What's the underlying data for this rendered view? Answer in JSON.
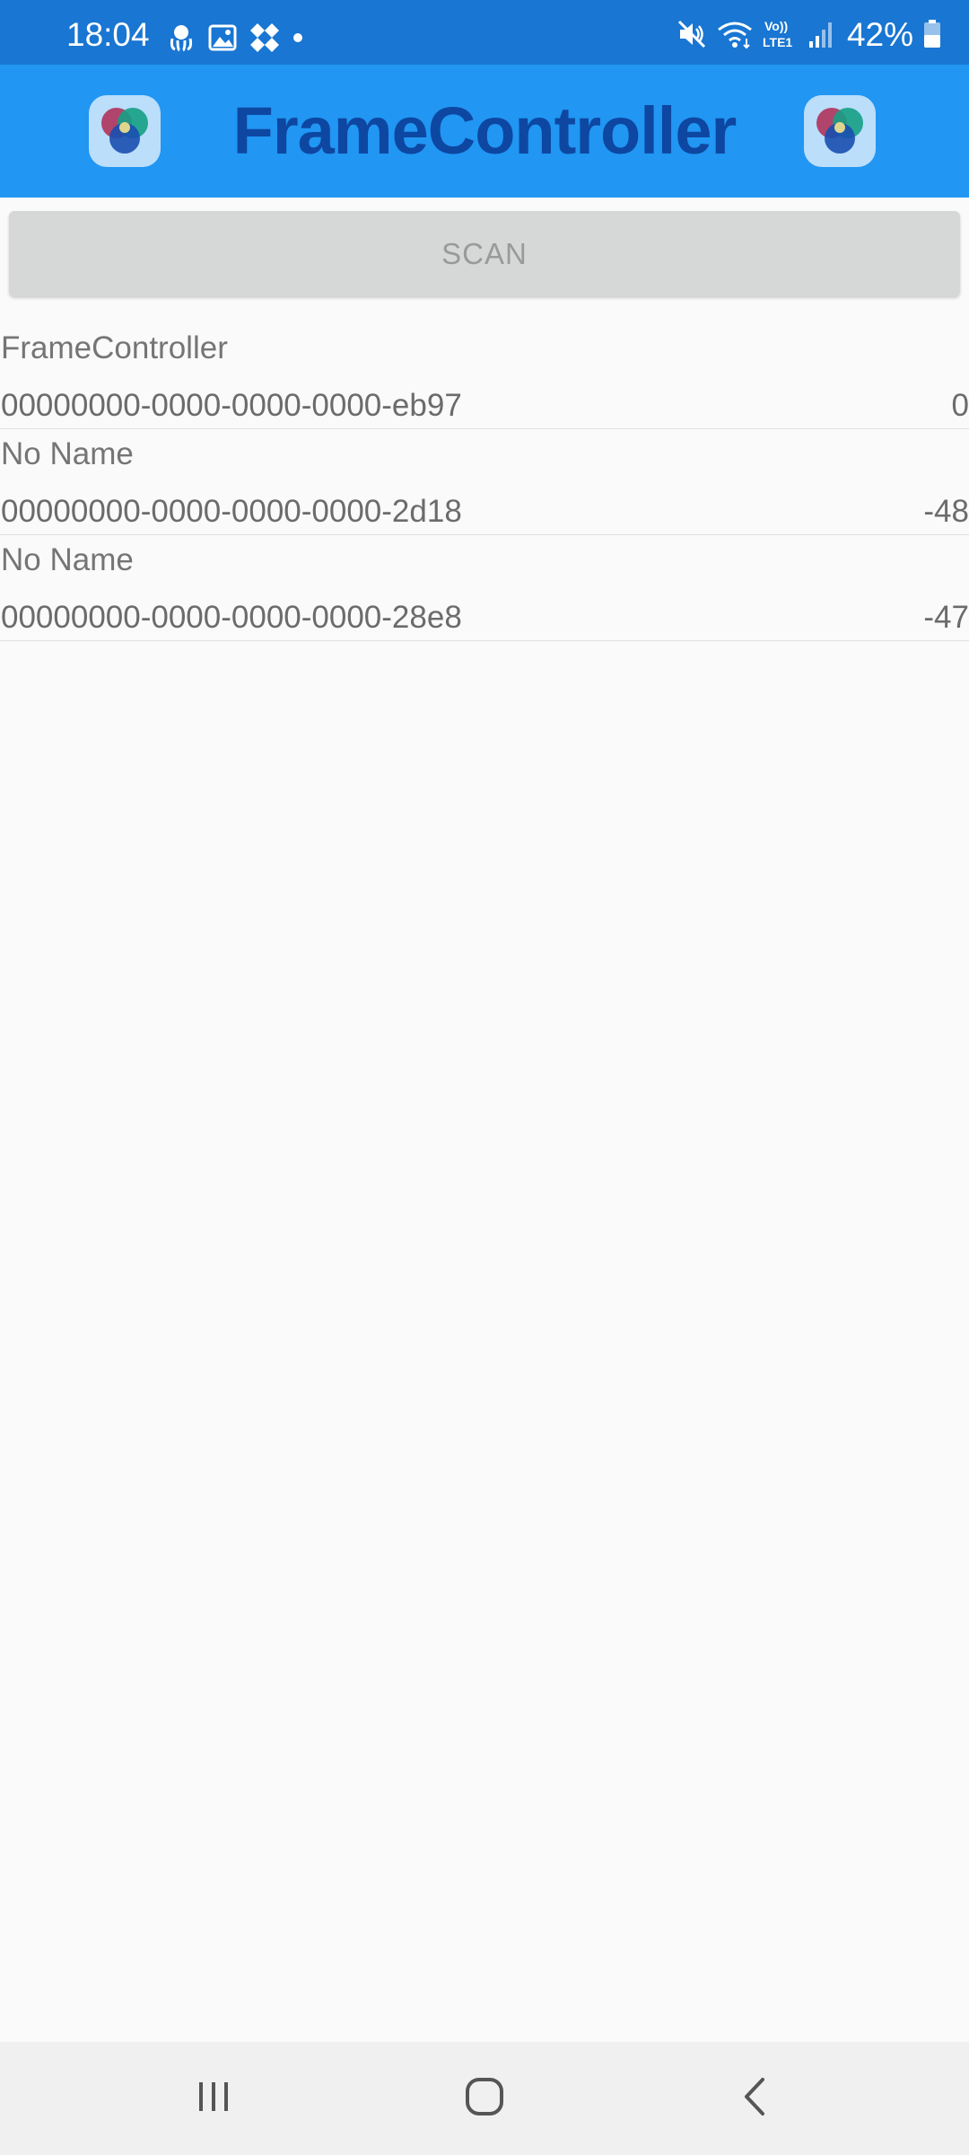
{
  "status_bar": {
    "time": "18:04",
    "battery_percent": "42%",
    "left_icons": [
      "octopus-notification-icon",
      "gallery-icon",
      "app-notification-icon",
      "more-notifications-dot"
    ],
    "right_icons": [
      "mute-icon",
      "wifi-icon",
      "volte-lte-icon",
      "signal-icon",
      "battery-icon"
    ],
    "network_label": "Vo)) LTE1"
  },
  "app_bar": {
    "title": "FrameController",
    "accent_color": "#2196f3",
    "title_color": "#0d47a1"
  },
  "scan_button": {
    "label": "SCAN"
  },
  "devices": [
    {
      "name": "FrameController",
      "uuid": "00000000-0000-0000-0000-eb97",
      "rssi": "0"
    },
    {
      "name": "No Name",
      "uuid": "00000000-0000-0000-0000-2d18",
      "rssi": "-48"
    },
    {
      "name": "No Name",
      "uuid": "00000000-0000-0000-0000-28e8",
      "rssi": "-47"
    }
  ],
  "nav_bar": {
    "items": [
      "recent-apps",
      "home",
      "back"
    ]
  }
}
